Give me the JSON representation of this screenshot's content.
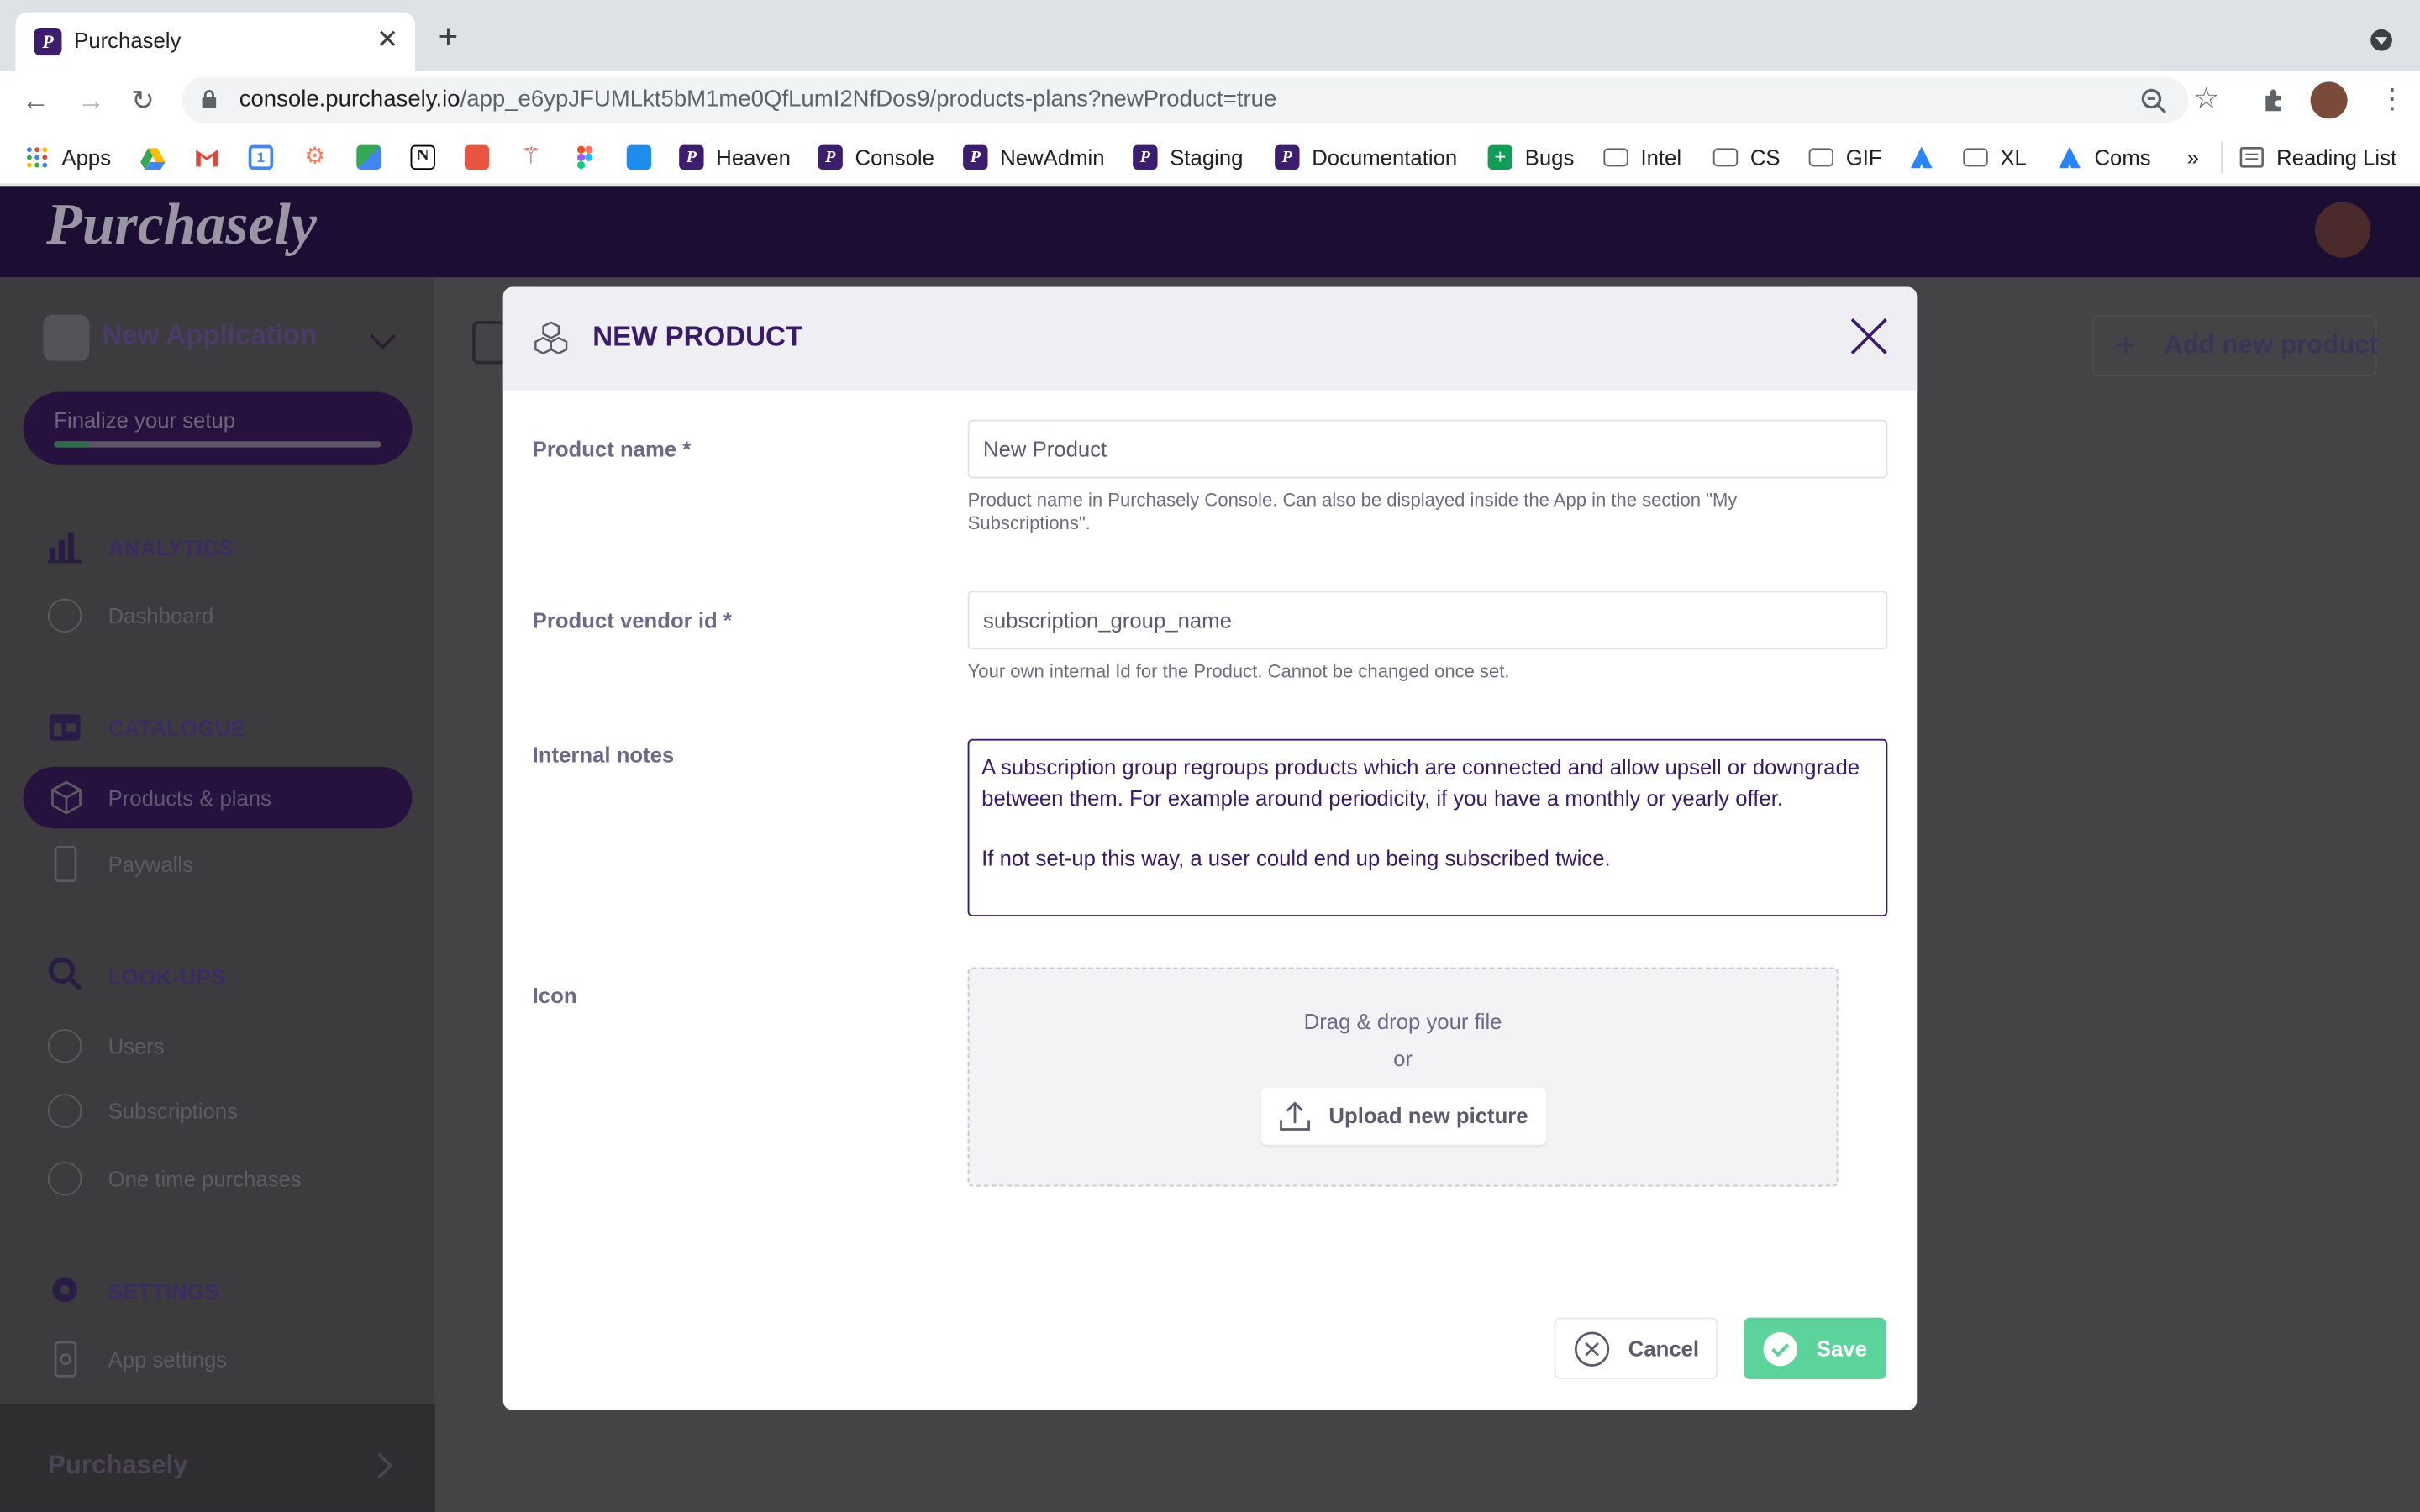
{
  "browser": {
    "tab_title": "Purchasely",
    "tab_favicon": "P",
    "url_host": "console.purchasely.io",
    "url_path": "/app_e6ypJFUMLkt5bM1me0QfLumI2NfDos9/products-plans?newProduct=true",
    "bookmarks": [
      {
        "label": "Apps",
        "icon": "apps-grid-icon"
      },
      {
        "label": "",
        "icon": "google-drive-icon"
      },
      {
        "label": "",
        "icon": "gmail-icon"
      },
      {
        "label": "",
        "icon": "google-calendar-icon"
      },
      {
        "label": "",
        "icon": "hubspot-icon"
      },
      {
        "label": "",
        "icon": "google-maps-icon"
      },
      {
        "label": "",
        "icon": "notion-icon"
      },
      {
        "label": "",
        "icon": "bookmark-icon"
      },
      {
        "label": "",
        "icon": "bookmark-icon"
      },
      {
        "label": "",
        "icon": "figma-icon"
      },
      {
        "label": "",
        "icon": "intercom-icon"
      },
      {
        "label": "Heaven",
        "icon": "purchasely-icon"
      },
      {
        "label": "Console",
        "icon": "purchasely-icon"
      },
      {
        "label": "NewAdmin",
        "icon": "purchasely-icon"
      },
      {
        "label": "Staging",
        "icon": "purchasely-icon"
      },
      {
        "label": "Documentation",
        "icon": "purchasely-icon"
      },
      {
        "label": "Bugs",
        "icon": "sheets-icon"
      },
      {
        "label": "Intel",
        "icon": "folder-icon"
      },
      {
        "label": "CS",
        "icon": "folder-icon"
      },
      {
        "label": "GIF",
        "icon": "folder-icon"
      },
      {
        "label": "",
        "icon": "atlassian-icon"
      },
      {
        "label": "XL",
        "icon": "folder-icon"
      },
      {
        "label": "Coms",
        "icon": "atlassian-icon"
      }
    ],
    "overflow": "»",
    "reading_list": "Reading List"
  },
  "app": {
    "logo_text": "Purchasely",
    "app_name": "New Application",
    "finalize_label": "Finalize your setup",
    "setup_progress": 0.11,
    "sidebar": {
      "analytics": {
        "title": "ANALYTICS",
        "items": [
          "Dashboard"
        ]
      },
      "catalogue": {
        "title": "CATALOGUE",
        "items": [
          "Products & plans",
          "Paywalls"
        ]
      },
      "lookups": {
        "title": "LOOK-UPS",
        "items": [
          "Users",
          "Subscriptions",
          "One time purchases"
        ]
      },
      "settings": {
        "title": "SETTINGS",
        "items": [
          "App settings"
        ]
      }
    },
    "footer_label": "Purchasely",
    "add_product_label": "Add new product"
  },
  "modal": {
    "title": "NEW PRODUCT",
    "product_name_label": "Product name *",
    "product_name_value": "New Product",
    "product_name_hint": "Product name in Purchasely Console. Can also be displayed inside the App in the section \"My Subscriptions\".",
    "vendor_id_label": "Product vendor id *",
    "vendor_id_placeholder": "subscription_group_name",
    "vendor_id_hint": "Your own internal Id for the Product. Cannot be changed once set.",
    "notes_label": "Internal notes",
    "notes_value": "A subscription group regroups products which are connected and allow upsell or downgrade between them. For example around periodicity, if you have a monthly or yearly offer.\n\nIf not set-up this way, a user could end up being subscribed twice.",
    "icon_label": "Icon",
    "drop_text": "Drag & drop your file",
    "drop_or": "or",
    "upload_label": "Upload new picture",
    "cancel_label": "Cancel",
    "save_label": "Save"
  },
  "colors": {
    "brand_purple": "#3a1a6b",
    "header_dark": "#1c0d33",
    "save_green": "#5bd39a"
  }
}
